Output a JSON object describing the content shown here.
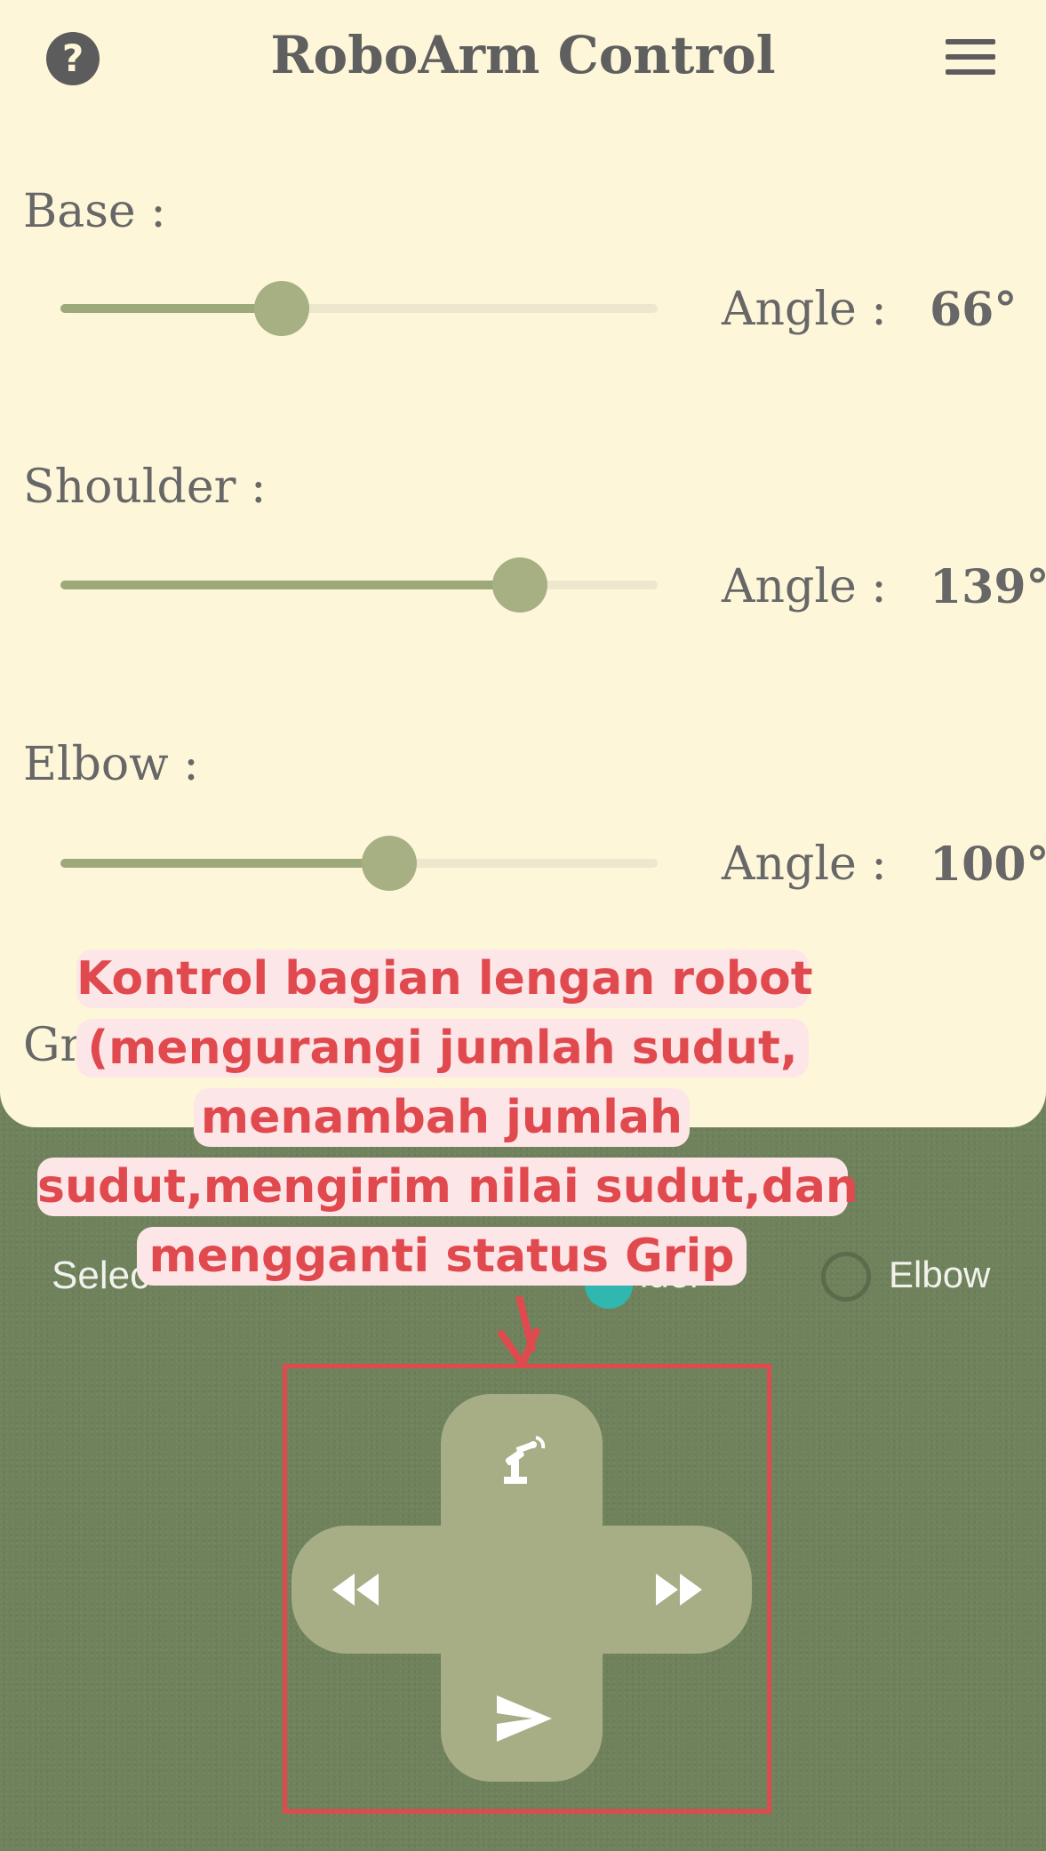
{
  "header": {
    "title": "RoboArm Control",
    "help_icon": "help-icon",
    "menu_icon": "menu-icon"
  },
  "joints": [
    {
      "label": "Base  :",
      "angle_label": "Angle  :",
      "angle_value": "66°",
      "fraction": 0.37
    },
    {
      "label": "Shoulder  :",
      "angle_label": "Angle  :",
      "angle_value": "139°",
      "fraction": 0.77
    },
    {
      "label": "Elbow  :",
      "angle_label": "Angle  :",
      "angle_value": "100°",
      "fraction": 0.55
    }
  ],
  "grip_partial": "Gr",
  "selector": {
    "select_partial": "Selec",
    "shoulder_partial": "lder",
    "elbow_label": "Elbow"
  },
  "dpad": {
    "up_icon": "robot-arm-icon",
    "left_icon": "rewind-icon",
    "right_icon": "fast-forward-icon",
    "down_icon": "send-icon"
  },
  "annotation": {
    "lines": [
      "Kontrol bagian lengan robot",
      "(mengurangi jumlah sudut,",
      "menambah jumlah",
      "sudut,mengirim nilai sudut,dan",
      "mengganti status Grip"
    ]
  },
  "colors": {
    "panel": "#fdf6d9",
    "background": "#6f825c",
    "accent": "#a7ae85",
    "annotation": "#e04a4f"
  }
}
